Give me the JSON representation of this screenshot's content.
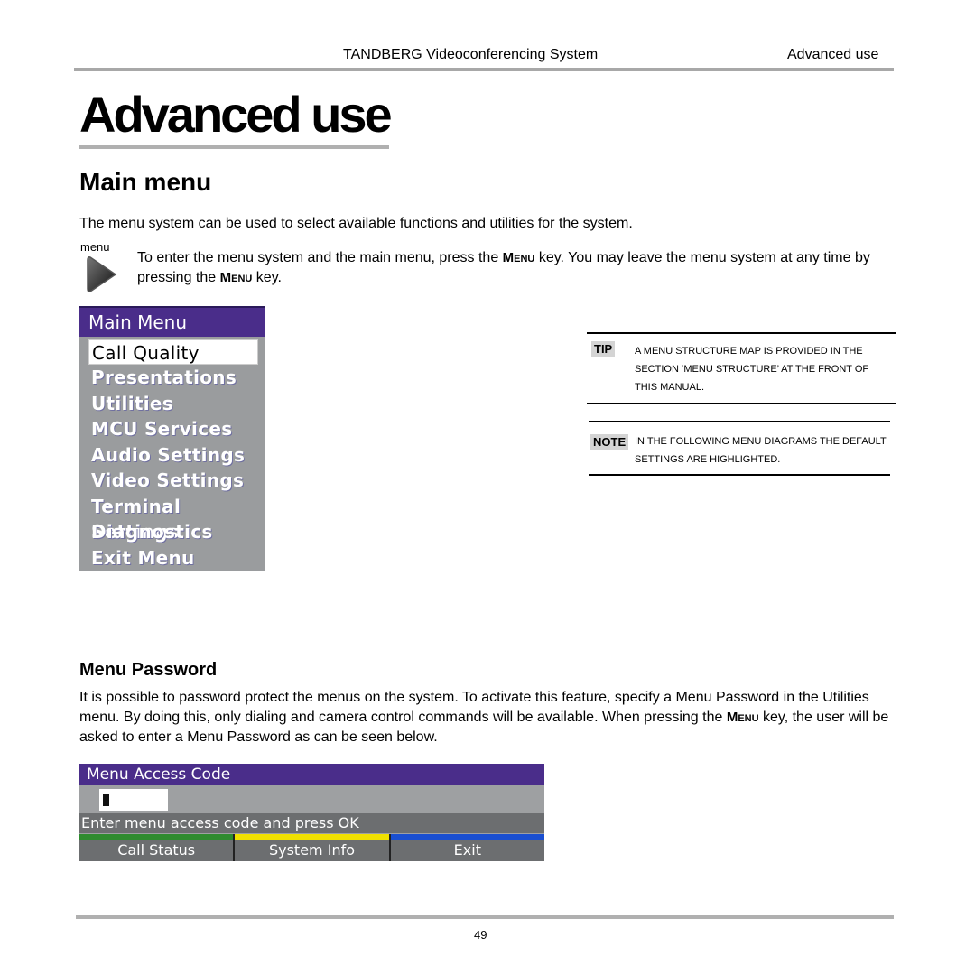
{
  "header": {
    "doc_title": "TANDBERG Videoconferencing System",
    "section": "Advanced use"
  },
  "chapter_title": "Advanced use",
  "section_title": "Main menu",
  "intro": "The menu system can be used to select available functions and utilities for the system.",
  "menu_key": {
    "label": "menu",
    "icon": "menu-key-icon",
    "text_before": "To enter the menu system and the main menu, press the ",
    "key1": "Menu",
    "text_middle": " key. You may leave the menu system at any time by pressing the ",
    "key2": "Menu",
    "text_after": " key."
  },
  "main_menu": {
    "title": "Main Menu",
    "items": [
      {
        "label": "Call Quality",
        "selected": true
      },
      {
        "label": "Presentations"
      },
      {
        "label": "Utilities"
      },
      {
        "label": "MCU Services"
      },
      {
        "label": "Audio Settings"
      },
      {
        "label": "Video Settings"
      },
      {
        "label": "Terminal Settings"
      },
      {
        "label": "Diagnostics"
      },
      {
        "label": "Exit Menu"
      }
    ]
  },
  "tip": {
    "badge": "TIP",
    "text": "A menu structure map is provided in the section ‘Menu structure’ at the front of this manual."
  },
  "note": {
    "badge": "NOTE",
    "text": "In the following menu diagrams the default settings are highlighted."
  },
  "menu_password": {
    "title": "Menu Password",
    "text_before": "It is possible to password protect the menus on the system. To activate this feature, specify a Menu Password in the Utilities menu. By doing this, only dialing and camera control commands will be available. When pressing the ",
    "key": "Menu",
    "text_after": " key, the user will be asked to enter a Menu Password as can be seen below."
  },
  "access_code": {
    "title": "Menu Access Code",
    "input_value": "",
    "prompt": "Enter menu access code and press OK",
    "buttons": [
      {
        "label": "Call Status",
        "color": "#2e8b2e"
      },
      {
        "label": "System Info",
        "color": "#f0e000"
      },
      {
        "label": "Exit",
        "color": "#1a4fd0"
      }
    ]
  },
  "page_number": "49"
}
